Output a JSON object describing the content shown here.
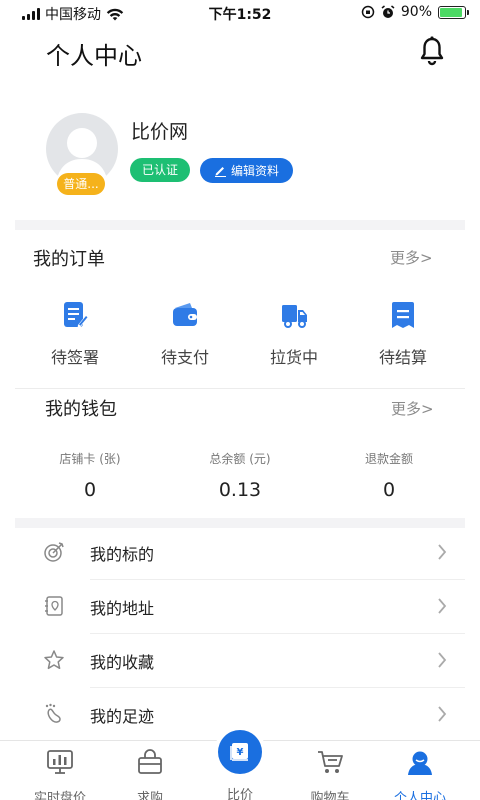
{
  "status_bar": {
    "carrier": "中国移动",
    "time": "下午1:52",
    "battery_percent": "90%",
    "battery_level": 0.9
  },
  "header": {
    "title": "个人中心"
  },
  "profile": {
    "name": "比价网",
    "level": "普通...",
    "verified_label": "已认证",
    "edit_label": "编辑资料"
  },
  "orders": {
    "title": "我的订单",
    "more": "更多>",
    "items": [
      {
        "label": "待签署",
        "icon": "sign-document-icon"
      },
      {
        "label": "待支付",
        "icon": "wallet-icon"
      },
      {
        "label": "拉货中",
        "icon": "truck-icon"
      },
      {
        "label": "待结算",
        "icon": "receipt-icon"
      }
    ]
  },
  "wallet": {
    "title": "我的钱包",
    "more": "更多>",
    "stats": [
      {
        "caption": "店铺卡 (张)",
        "value": "0"
      },
      {
        "caption": "总余额 (元)",
        "value": "0.13"
      },
      {
        "caption": "退款金额",
        "value": "0"
      }
    ]
  },
  "menu": [
    {
      "label": "我的标的",
      "icon": "target-icon"
    },
    {
      "label": "我的地址",
      "icon": "address-icon"
    },
    {
      "label": "我的收藏",
      "icon": "star-icon"
    },
    {
      "label": "我的足迹",
      "icon": "footprint-icon"
    }
  ],
  "tabs": [
    {
      "label": "实时盘价",
      "icon": "chart-monitor-icon"
    },
    {
      "label": "求购",
      "icon": "basket-icon"
    },
    {
      "label": "比价",
      "icon": "yen-card-icon"
    },
    {
      "label": "购物车",
      "icon": "cart-icon"
    },
    {
      "label": "个人中心",
      "icon": "user-icon"
    }
  ],
  "colors": {
    "accent": "#1a6fe0",
    "verified": "#1dbf73",
    "level_badge": "#f5b21b"
  }
}
